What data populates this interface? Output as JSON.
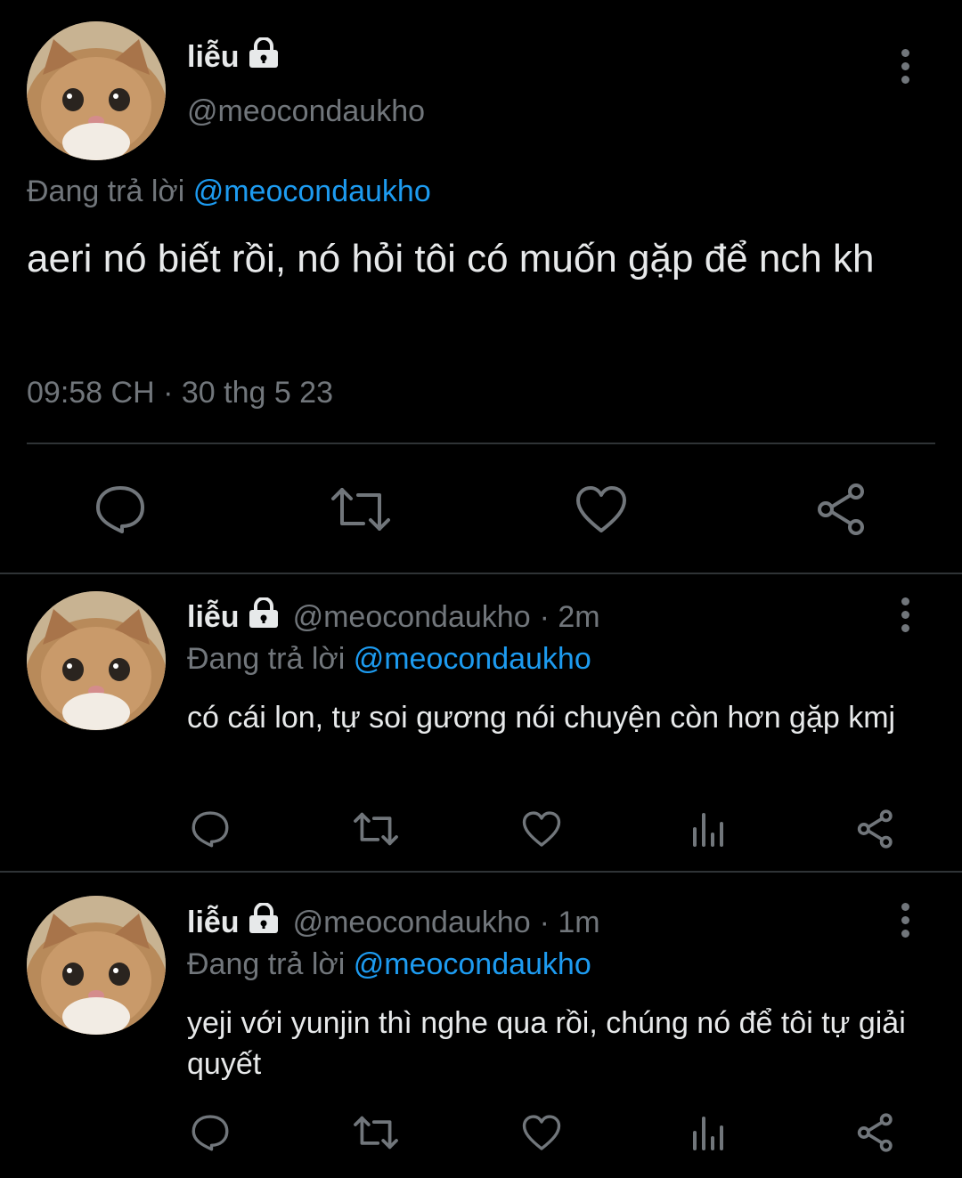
{
  "main_tweet": {
    "display_name": "liễu",
    "handle": "@meocondaukho",
    "replying_prefix": "Đang trả lời",
    "replying_to": "@meocondaukho",
    "text": "aeri nó biết rồi, nó hỏi tôi có muốn gặp để nch kh",
    "timestamp": "09:58 CH · 30 thg 5 23",
    "actions": [
      "reply-icon",
      "retweet-icon",
      "like-icon",
      "share-icon"
    ]
  },
  "replies": [
    {
      "display_name": "liễu",
      "handle": "@meocondaukho",
      "time": "· 2m",
      "replying_prefix": "Đang trả lời",
      "replying_to": "@meocondaukho",
      "text": "có cái lon, tự soi gương nói chuyện còn hơn gặp kmj"
    },
    {
      "display_name": "liễu",
      "handle": "@meocondaukho",
      "time": "· 1m",
      "replying_prefix": "Đang trả lời",
      "replying_to": "@meocondaukho",
      "text": "yeji với yunjin thì nghe qua rồi, chúng nó để tôi tự giải quyết"
    }
  ],
  "colors": {
    "background": "#000000",
    "text": "#e7e9ea",
    "muted": "#71767b",
    "accent": "#1d9bf0",
    "divider": "#2f3336"
  }
}
